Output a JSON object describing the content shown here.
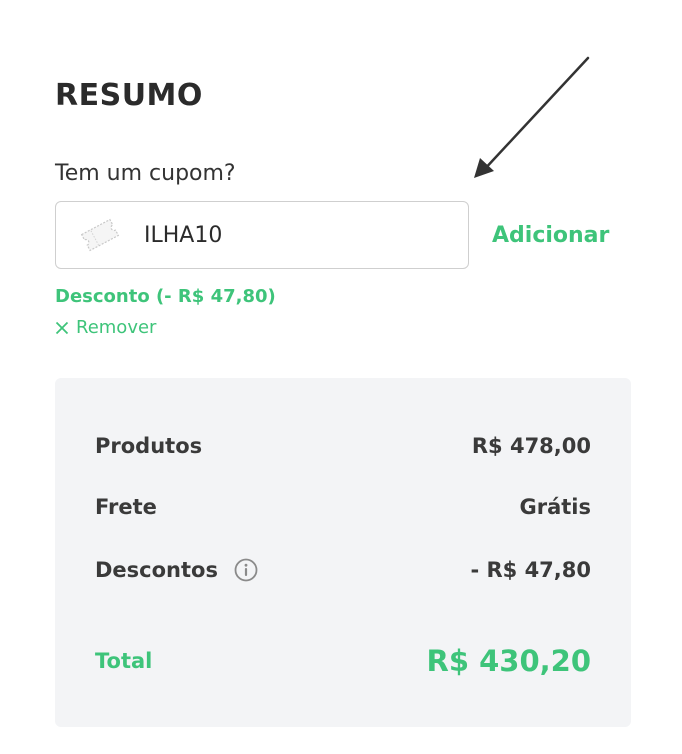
{
  "summary": {
    "title": "RESUMO"
  },
  "coupon": {
    "label": "Tem um cupom?",
    "value": "ILHA10",
    "add_label": "Adicionar",
    "discount_text": "Desconto (- R$ 47,80)",
    "remove_label": "Remover",
    "icon": "ticket-icon"
  },
  "totals": {
    "products_label": "Produtos",
    "products_value": "R$ 478,00",
    "shipping_label": "Frete",
    "shipping_value": "Grátis",
    "discounts_label": "Descontos",
    "discounts_value": "- R$ 47,80",
    "total_label": "Total",
    "total_value": "R$ 430,20"
  },
  "colors": {
    "accent": "#3ec47a",
    "text": "#2b2b2b",
    "panel": "#f3f4f6",
    "border": "#cfcfcf"
  }
}
